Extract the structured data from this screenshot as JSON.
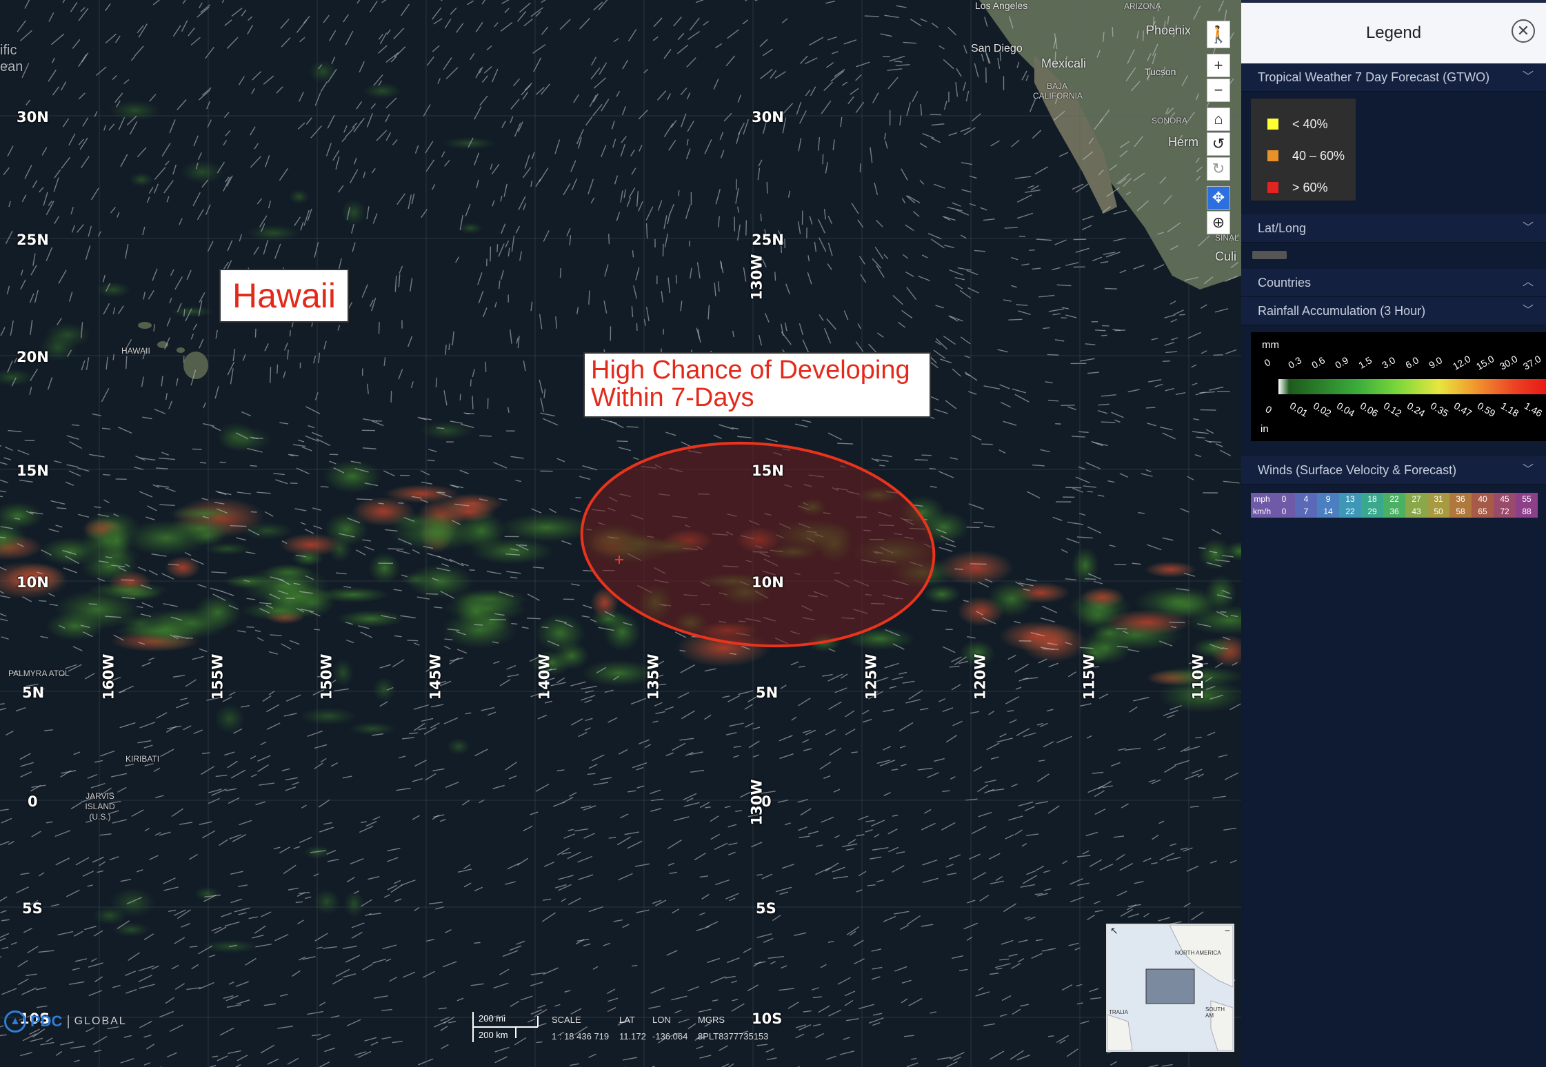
{
  "map": {
    "lat_labels_left": [
      {
        "text": "30N"
      },
      {
        "text": "25N"
      },
      {
        "text": "20N"
      },
      {
        "text": "15N"
      },
      {
        "text": "10N"
      },
      {
        "text": "5N"
      },
      {
        "text": "0"
      },
      {
        "text": "5S"
      },
      {
        "text": "10S"
      }
    ],
    "lat_labels_center": [
      {
        "text": "30N"
      },
      {
        "text": "25N"
      },
      {
        "text": "15N"
      },
      {
        "text": "10N"
      },
      {
        "text": "5N"
      },
      {
        "text": "0"
      },
      {
        "text": "5S"
      },
      {
        "text": "10S"
      }
    ],
    "lon_labels": [
      {
        "text": "160W"
      },
      {
        "text": "155W"
      },
      {
        "text": "150W"
      },
      {
        "text": "145W"
      },
      {
        "text": "140W"
      },
      {
        "text": "135W"
      },
      {
        "text": "125W"
      },
      {
        "text": "120W"
      },
      {
        "text": "115W"
      },
      {
        "text": "110W"
      }
    ],
    "lon_130": "130W",
    "places": {
      "pacific_ocean_top": "ific",
      "pacific_ocean_bottom": "ean",
      "hawaii": "HAWAII",
      "palmyra": "PALMYRA ATOL",
      "kiribati": "KIRIBATI",
      "jarvis": "JARVIS ISLAND (U.S.)",
      "los_angeles": "Los Angeles",
      "arizona": "ARIZONA",
      "phoenix": "Phoenix",
      "san_diego": "San Diego",
      "mexicali": "Mexicali",
      "tucson": "Tucson",
      "baja": "BAJA CALIFORNIA",
      "sonora": "SONORA",
      "hermosillo": "Herm",
      "culiacan": "Culi",
      "sinaloa": "SINAL"
    },
    "callouts": {
      "hawaii": "Hawaii",
      "developing_line1": "High Chance of Developing",
      "developing_line2": "Within 7-Days"
    },
    "colors": {
      "outlook_ellipse": "#e8341c",
      "outlook_fill": "#6e1e1e"
    }
  },
  "toolbar": {
    "icons": [
      "person-icon",
      "zoom-in-icon",
      "zoom-out-icon",
      "home-icon",
      "rotate-ccw-icon",
      "rotate-cw-icon",
      "pan-icon",
      "zoom-box-icon"
    ]
  },
  "legend": {
    "title": "Legend",
    "close": "✕",
    "sections": {
      "gtwo": "Tropical Weather 7 Day Forecast (GTWO)",
      "latlong": "Lat/Long",
      "countries": "Countries",
      "rain": "Rainfall Accumulation (3 Hour)",
      "winds": "Winds (Surface Velocity & Forecast)"
    },
    "gtwo_items": [
      {
        "label": "< 40%",
        "color": "#ffff33"
      },
      {
        "label": "40 – 60%",
        "color": "#e8902a"
      },
      {
        "label": "> 60%",
        "color": "#e32222"
      }
    ],
    "rain": {
      "unit_mm": "mm",
      "unit_in": "in",
      "mm_ticks": [
        "0",
        "0.3",
        "0.6",
        "0.9",
        "1.5",
        "3.0",
        "6.0",
        "9.0",
        "12.0",
        "15.0",
        "30.0",
        "37.0"
      ],
      "in_ticks": [
        "0",
        "0.01",
        "0.02",
        "0.04",
        "0.06",
        "0.12",
        "0.24",
        "0.35",
        "0.47",
        "0.59",
        "1.18",
        "1.46"
      ]
    },
    "winds": {
      "mph_label": "mph",
      "kmh_label": "km/h",
      "mph": [
        "0",
        "4",
        "9",
        "13",
        "18",
        "22",
        "27",
        "31",
        "36",
        "40",
        "45",
        "55"
      ],
      "kmh": [
        "0",
        "7",
        "14",
        "22",
        "29",
        "36",
        "43",
        "50",
        "58",
        "65",
        "72",
        "88"
      ],
      "colors": [
        "#6f5aa8",
        "#5a6ab8",
        "#4c7fc0",
        "#3f97b8",
        "#3aa88e",
        "#4cb064",
        "#8aa848",
        "#a89a40",
        "#b0783c",
        "#a85a48",
        "#9a4a6a",
        "#8e3f8a"
      ]
    }
  },
  "bottom": {
    "logo": "PDC",
    "global": "GLOBAL",
    "scale_mi": "200 mi",
    "scale_km": "200 km",
    "scale_label": "SCALE",
    "scale_value": "1 : 18 436 719",
    "lat_label": "LAT",
    "lat_value": "11.172",
    "lon_label": "LON",
    "lon_value": "-136.064",
    "mgrs_label": "MGRS",
    "mgrs_value": "8PLT8377735153"
  },
  "minimap": {
    "north_america": "NORTH AMERICA",
    "south_america": "SOUTH AM",
    "australia": "TRALIA"
  }
}
